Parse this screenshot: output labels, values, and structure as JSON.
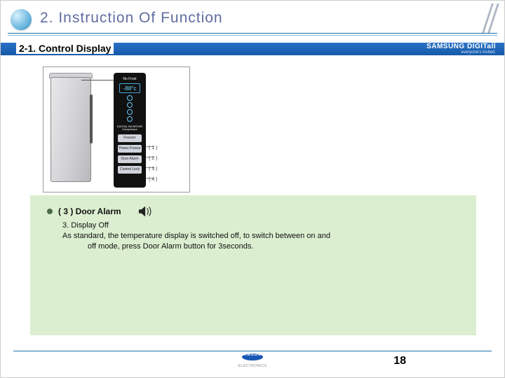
{
  "header": {
    "title": "2. Instruction Of Function"
  },
  "subsection": {
    "label": "2-1. Control Display"
  },
  "brand": {
    "name": "SAMSUNG DIGITall",
    "tagline": "everyone's invited."
  },
  "fridge_panel": {
    "top_label": "No Frost",
    "temperature": "-88°c",
    "logo_line1": "DIGITAL INVERTER",
    "logo_line2": "Compressor",
    "buttons": [
      "Freezer",
      "Power Freeze",
      "Door Alarm",
      "Control Lock"
    ],
    "button_refs": [
      "( 1 )",
      "( 2 )",
      "( 3 )",
      "( 4 )"
    ]
  },
  "section": {
    "title": "( 3 ) Door Alarm",
    "sub_heading": "3. Display Off",
    "body_line1": "As standard, the temperature display is switched off, to switch between on and",
    "body_line2": "off mode, press Door Alarm button for 3seconds."
  },
  "footer": {
    "logo_text": "SAMSUNG",
    "logo_sub": "ELECTRONICS"
  },
  "page_number": "18"
}
